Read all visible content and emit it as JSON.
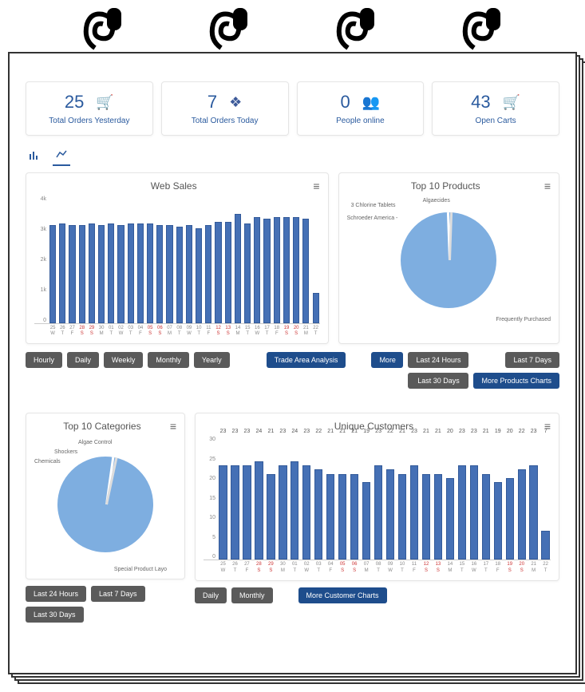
{
  "stats": [
    {
      "value": "25",
      "label": "Total Orders Yesterday",
      "icon": "cart"
    },
    {
      "value": "7",
      "label": "Total Orders Today",
      "icon": "cubes"
    },
    {
      "value": "0",
      "label": "People online",
      "icon": "users"
    },
    {
      "value": "43",
      "label": "Open Carts",
      "icon": "cart"
    }
  ],
  "web_sales": {
    "title": "Web Sales",
    "buttons": [
      "Hourly",
      "Daily",
      "Weekly",
      "Monthly",
      "Yearly"
    ],
    "action": "Trade Area Analysis"
  },
  "top_products": {
    "title": "Top 10 Products",
    "labels": [
      "3 Chlorine Tablets",
      "Algaecides",
      "Schroeder America -",
      "Frequently Purchased"
    ],
    "side_btn": "More",
    "time_btns": [
      "Last 24 Hours",
      "Last 7 Days",
      "Last 30 Days"
    ],
    "action": "More Products Charts"
  },
  "top_categories": {
    "title": "Top 10 Categories",
    "labels": [
      "Algae Control",
      "Shockers",
      "Chemicals",
      "Special Product Layo"
    ],
    "time_btns": [
      "Last 24 Hours",
      "Last 7 Days",
      "Last 30 Days"
    ]
  },
  "unique_customers": {
    "title": "Unique Customers",
    "buttons": [
      "Daily",
      "Monthly"
    ],
    "action": "More Customer Charts"
  },
  "chart_data": [
    {
      "type": "bar",
      "title": "Web Sales",
      "ylim": [
        0,
        4000
      ],
      "yticks": [
        "0",
        "1k",
        "2k",
        "3k",
        "4k"
      ],
      "categories": [
        "25 W",
        "26 T",
        "27 F",
        "28 S",
        "29 S",
        "30 M",
        "01 T",
        "02 W",
        "03 T",
        "04 F",
        "05 S",
        "06 S",
        "07 M",
        "08 T",
        "09 W",
        "10 T",
        "11 F",
        "12 S",
        "13 S",
        "14 M",
        "15 T",
        "16 W",
        "17 T",
        "18 F",
        "19 S",
        "20 S",
        "21 M",
        "22 T"
      ],
      "weekend_indices": [
        3,
        4,
        10,
        11,
        17,
        18,
        24,
        25
      ],
      "values": [
        3100,
        3150,
        3100,
        3100,
        3150,
        3100,
        3150,
        3100,
        3150,
        3150,
        3150,
        3100,
        3100,
        3050,
        3100,
        3000,
        3100,
        3200,
        3200,
        3450,
        3150,
        3350,
        3300,
        3350,
        3350,
        3350,
        3300,
        950
      ]
    },
    {
      "type": "pie",
      "title": "Top 10 Products",
      "series": [
        {
          "name": "Frequently Purchased",
          "value": 94
        },
        {
          "name": "Algaecides",
          "value": 2
        },
        {
          "name": "3 Chlorine Tablets",
          "value": 2
        },
        {
          "name": "Schroeder America -",
          "value": 2
        }
      ]
    },
    {
      "type": "pie",
      "title": "Top 10 Categories",
      "series": [
        {
          "name": "Special Product Layo",
          "value": 94
        },
        {
          "name": "Algae Control",
          "value": 2
        },
        {
          "name": "Shockers",
          "value": 2
        },
        {
          "name": "Chemicals",
          "value": 2
        }
      ]
    },
    {
      "type": "bar",
      "title": "Unique Customers",
      "ylim": [
        0,
        30
      ],
      "yticks": [
        "0",
        "5",
        "10",
        "15",
        "20",
        "25",
        "30"
      ],
      "categories": [
        "25 W",
        "26 T",
        "27 F",
        "28 S",
        "29 S",
        "30 M",
        "01 T",
        "02 W",
        "03 T",
        "04 F",
        "05 S",
        "06 S",
        "07 M",
        "08 T",
        "09 W",
        "10 T",
        "11 F",
        "12 S",
        "13 S",
        "14 M",
        "15 T",
        "16 W",
        "17 T",
        "18 F",
        "19 S",
        "20 S",
        "21 M",
        "22 T"
      ],
      "weekend_indices": [
        3,
        4,
        10,
        11,
        17,
        18,
        24,
        25
      ],
      "values": [
        23,
        23,
        23,
        24,
        21,
        23,
        24,
        23,
        22,
        21,
        21,
        21,
        19,
        23,
        22,
        21,
        23,
        21,
        21,
        20,
        23,
        23,
        21,
        19,
        20,
        22,
        23,
        7
      ]
    }
  ]
}
